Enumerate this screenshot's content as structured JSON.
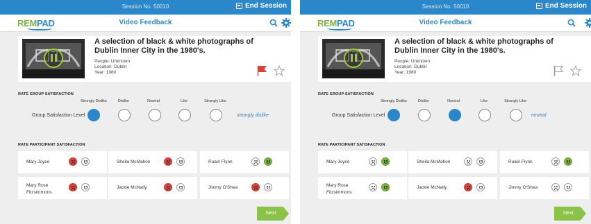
{
  "colors": {
    "accent": "#2a87c9",
    "green": "#7cb342",
    "red": "#d9443a"
  },
  "screens": [
    {
      "topbar": {
        "session": "Session No. 50010",
        "end_session": "End Session"
      },
      "header": {
        "logo_a": "REM",
        "logo_b": "PAD",
        "title": "Video Feedback"
      },
      "card": {
        "title": "A selection of black & white photographs of Dublin Inner City in the 1980's.",
        "people": "People: Unknown",
        "location": "Location: Dublin",
        "year": "Year: 1980",
        "flagged": true,
        "starred": false
      },
      "group": {
        "heading": "RATE GROUP SATISFACTION",
        "row_label": "Group Satisfaction Level",
        "options": [
          "Strongly Dislike",
          "Dislike",
          "Neutral",
          "Like",
          "Strongly Like"
        ],
        "selected": "strongly dislike"
      },
      "participants": {
        "heading": "RATE PARTICIPANT SATISFACTION",
        "people": [
          {
            "name": "Mary Joyce",
            "sad": "red",
            "happy": "none"
          },
          {
            "name": "Sheila McMahon",
            "sad": "red",
            "happy": "none"
          },
          {
            "name": "Ruairi Flynn",
            "sad": "none",
            "happy": "green"
          },
          {
            "name": "Mary Rose Fitzsimmons",
            "sad": "red",
            "happy": "none"
          },
          {
            "name": "Jackie McNally",
            "sad": "red",
            "happy": "none"
          },
          {
            "name": "Jimmy O'Shea",
            "sad": "red",
            "happy": "none"
          }
        ]
      },
      "next_label": "Next"
    },
    {
      "topbar": {
        "session": "Session No. 50010",
        "end_session": "End Session"
      },
      "header": {
        "logo_a": "REM",
        "logo_b": "PAD",
        "title": "Video Feedback"
      },
      "card": {
        "title": "A selection of black & white photographs of Dublin Inner City in the 1980's.",
        "people": "People: Unknown",
        "location": "Location: Dublin",
        "year": "Year: 1980",
        "flagged": false,
        "starred": false
      },
      "group": {
        "heading": "RATE GROUP SATISFACTION",
        "row_label": "Group Satisfaction Level",
        "options": [
          "Strongly Dislike",
          "Dislike",
          "Neutral",
          "Like",
          "Strongly Like"
        ],
        "selected": "neutral"
      },
      "participants": {
        "heading": "RATE PARTICIPANT SATISFACTION",
        "people": [
          {
            "name": "Mary Joyce",
            "sad": "none",
            "happy": "green"
          },
          {
            "name": "Sheila McMahon",
            "sad": "none",
            "happy": "none"
          },
          {
            "name": "Ruairi Flynn",
            "sad": "none",
            "happy": "green"
          },
          {
            "name": "Mary Rose Fitzsimmons",
            "sad": "none",
            "happy": "green"
          },
          {
            "name": "Jackie McNally",
            "sad": "red",
            "happy": "none"
          },
          {
            "name": "Jimmy O'Shea",
            "sad": "none",
            "happy": "none"
          }
        ]
      },
      "next_label": "Next"
    }
  ]
}
